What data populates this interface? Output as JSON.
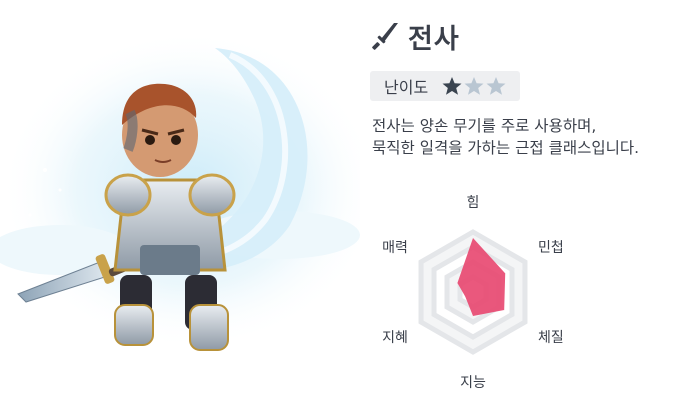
{
  "character": {
    "name": "전사",
    "class_icon": "sword-icon",
    "difficulty_label": "난이도",
    "difficulty_rating": 1,
    "difficulty_max": 3,
    "description_lines": [
      "전사는 양손 무기를 주로 사용하며,",
      "묵직한 일격을 가하는 근접 클래스입니다."
    ]
  },
  "stats": {
    "axes": [
      "힘",
      "민첩",
      "체질",
      "지능",
      "지혜",
      "매력"
    ],
    "values": [
      0.9,
      0.62,
      0.6,
      0.4,
      0.15,
      0.3
    ],
    "fill_color": "#e8466f",
    "ring_color": "#e4e6e9"
  },
  "colors": {
    "text": "#3a3f4a",
    "star_filled": "#3a4450",
    "star_empty": "#b9c6d2",
    "badge_bg": "#eeeff1"
  }
}
